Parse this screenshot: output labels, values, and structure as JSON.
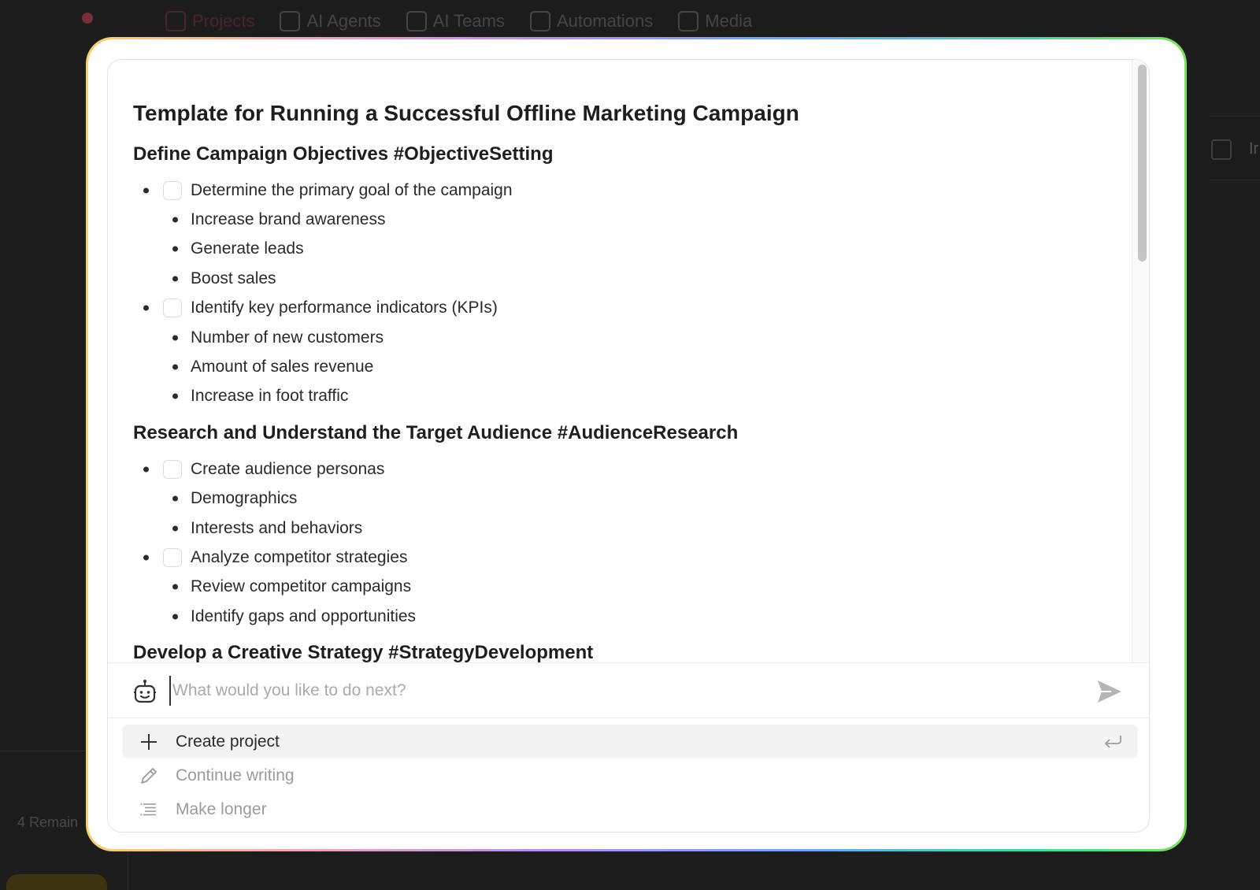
{
  "background": {
    "nav": [
      {
        "label": "Projects",
        "active": true
      },
      {
        "label": "AI Agents"
      },
      {
        "label": "AI Teams"
      },
      {
        "label": "Automations"
      },
      {
        "label": "Media"
      }
    ],
    "right_text": "Ir",
    "remaining_text": "4 Remain"
  },
  "document": {
    "title": "Template for Running a Successful Offline Marketing Campaign",
    "sections": [
      {
        "heading": "Define Campaign Objectives #ObjectiveSetting",
        "items": [
          {
            "label": "Determine the primary goal of the campaign",
            "checkbox": true,
            "subitems": [
              "Increase brand awareness",
              "Generate leads",
              "Boost sales"
            ]
          },
          {
            "label": "Identify key performance indicators (KPIs)",
            "checkbox": true,
            "subitems": [
              "Number of new customers",
              "Amount of sales revenue",
              "Increase in foot traffic"
            ]
          }
        ]
      },
      {
        "heading": "Research and Understand the Target Audience #AudienceResearch",
        "items": [
          {
            "label": "Create audience personas",
            "checkbox": true,
            "subitems": [
              "Demographics",
              "Interests and behaviors"
            ]
          },
          {
            "label": "Analyze competitor strategies",
            "checkbox": true,
            "subitems": [
              "Review competitor campaigns",
              "Identify gaps and opportunities"
            ]
          }
        ]
      },
      {
        "heading": "Develop a Creative Strategy #StrategyDevelopment",
        "items": []
      }
    ]
  },
  "prompt": {
    "placeholder": "What would you like to do next?",
    "value": ""
  },
  "suggestions": [
    {
      "label": "Create project",
      "icon": "plus-icon",
      "highlighted": true
    },
    {
      "label": "Continue writing",
      "icon": "pencil-icon",
      "highlighted": false
    },
    {
      "label": "Make longer",
      "icon": "lines-icon",
      "highlighted": false
    }
  ],
  "colors": {
    "accent_red": "#e8485c",
    "text_dark": "#1e1e1e",
    "muted": "#9b9b9b"
  }
}
